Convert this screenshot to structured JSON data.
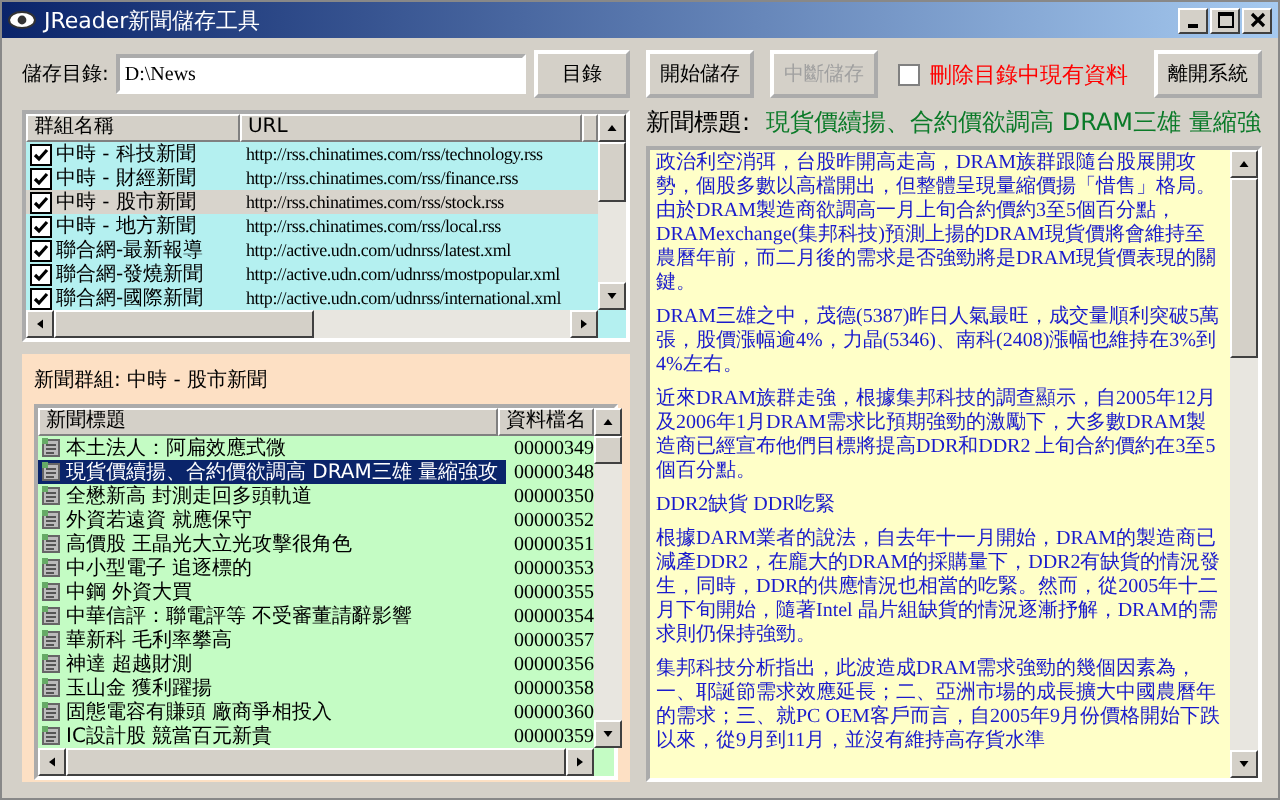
{
  "window": {
    "title": "JReader新聞儲存工具"
  },
  "directory": {
    "label": "儲存目錄:",
    "value": "D:\\News",
    "browse_button": "目錄"
  },
  "actions": {
    "start_button": {
      "label": "開始儲存",
      "disabled": false
    },
    "stop_button": {
      "label": "中斷儲存",
      "disabled": true
    },
    "delete_option": {
      "label": "刪除目錄中現有資料",
      "checked": false
    },
    "exit_button": "離開系統"
  },
  "groups": {
    "columns": [
      "群組名稱",
      "URL"
    ],
    "rows": [
      {
        "name": "中時 - 科技新聞",
        "url": "http://rss.chinatimes.com/rss/technology.rss",
        "checked": true,
        "selected": false
      },
      {
        "name": "中時 - 財經新聞",
        "url": "http://rss.chinatimes.com/rss/finance.rss",
        "checked": true,
        "selected": false
      },
      {
        "name": "中時 - 股市新聞",
        "url": "http://rss.chinatimes.com/rss/stock.rss",
        "checked": true,
        "selected": true
      },
      {
        "name": "中時 - 地方新聞",
        "url": "http://rss.chinatimes.com/rss/local.rss",
        "checked": true,
        "selected": false
      },
      {
        "name": "聯合網-最新報導",
        "url": "http://active.udn.com/udnrss/latest.xml",
        "checked": true,
        "selected": false
      },
      {
        "name": "聯合網-發燒新聞",
        "url": "http://active.udn.com/udnrss/mostpopular.xml",
        "checked": true,
        "selected": false
      },
      {
        "name": "聯合網-國際新聞",
        "url": "http://active.udn.com/udnrss/international.xml",
        "checked": true,
        "selected": false
      }
    ]
  },
  "news": {
    "group_label": "新聞群組: 中時 - 股市新聞",
    "columns": [
      "新聞標題",
      "資料檔名"
    ],
    "rows": [
      {
        "title": "本土法人：阿扁效應式微",
        "file": "00000349",
        "selected": false
      },
      {
        "title": "現貨價續揚、合約價欲調高 DRAM三雄 量縮強攻",
        "file": "00000348",
        "selected": true
      },
      {
        "title": "全懋新高 封測走回多頭軌道",
        "file": "00000350",
        "selected": false
      },
      {
        "title": "外資若遠資 就應保守",
        "file": "00000352",
        "selected": false
      },
      {
        "title": "高價股 王晶光大立光攻擊很角色",
        "file": "00000351",
        "selected": false
      },
      {
        "title": "中小型電子 追逐標的",
        "file": "00000353",
        "selected": false
      },
      {
        "title": "中鋼 外資大買",
        "file": "00000355",
        "selected": false
      },
      {
        "title": "中華信評：聯電評等 不受審董請辭影響",
        "file": "00000354",
        "selected": false
      },
      {
        "title": "華新科 毛利率攀高",
        "file": "00000357",
        "selected": false
      },
      {
        "title": "神達 超越財測",
        "file": "00000356",
        "selected": false
      },
      {
        "title": "玉山金 獲利躍揚",
        "file": "00000358",
        "selected": false
      },
      {
        "title": "固態電容有賺頭 廠商爭相投入",
        "file": "00000360",
        "selected": false
      },
      {
        "title": "IC設計股 競當百元新貴",
        "file": "00000359",
        "selected": false
      }
    ]
  },
  "article": {
    "heading_label": "新聞標題:",
    "heading": "現貨價續揚、合約價欲調高 DRAM三雄 量縮強",
    "paragraphs": [
      "政治利空消弭，台股昨開高走高，DRAM族群跟隨台股展開攻勢，個股多數以高檔開出，但整體呈現量縮價揚「惜售」格局。由於DRAM製造商欲調高一月上旬合約價約3至5個百分點，DRAMexchange(集邦科技)預測上揚的DRAM現貨價將會維持至農曆年前，而二月後的需求是否強勁將是DRAM現貨價表現的關鍵。",
      "DRAM三雄之中，茂德(5387)昨日人氣最旺，成交量順利突破5萬張，股價漲幅逾4%，力晶(5346)、南科(2408)漲幅也維持在3%到4%左右。",
      "近來DRAM族群走強，根據集邦科技的調查顯示，自2005年12月及2006年1月DRAM需求比預期強勁的激勵下，大多數DRAM製造商已經宣布他們目標將提高DDR和DDR2 上旬合約價約在3至5個百分點。",
      "DDR2缺貨 DDR吃緊",
      "根據DARM業者的說法，自去年十一月開始，DRAM的製造商已減產DDR2，在龐大的DRAM的採購量下，DDR2有缺貨的情況發生，同時，DDR的供應情況也相當的吃緊。然而，從2005年十二月下旬開始，隨著Intel 晶片組缺貨的情況逐漸抒解，DRAM的需求則仍保持強勁。",
      "集邦科技分析指出，此波造成DRAM需求強勁的幾個因素為，一、耶誕節需求效應延長；二、亞洲市場的成長擴大中國農曆年的需求；三、就PC OEM客戶而言，自2005年9月份價格開始下跌以來，從9月到11月，並沒有維持高存貨水準"
    ]
  }
}
